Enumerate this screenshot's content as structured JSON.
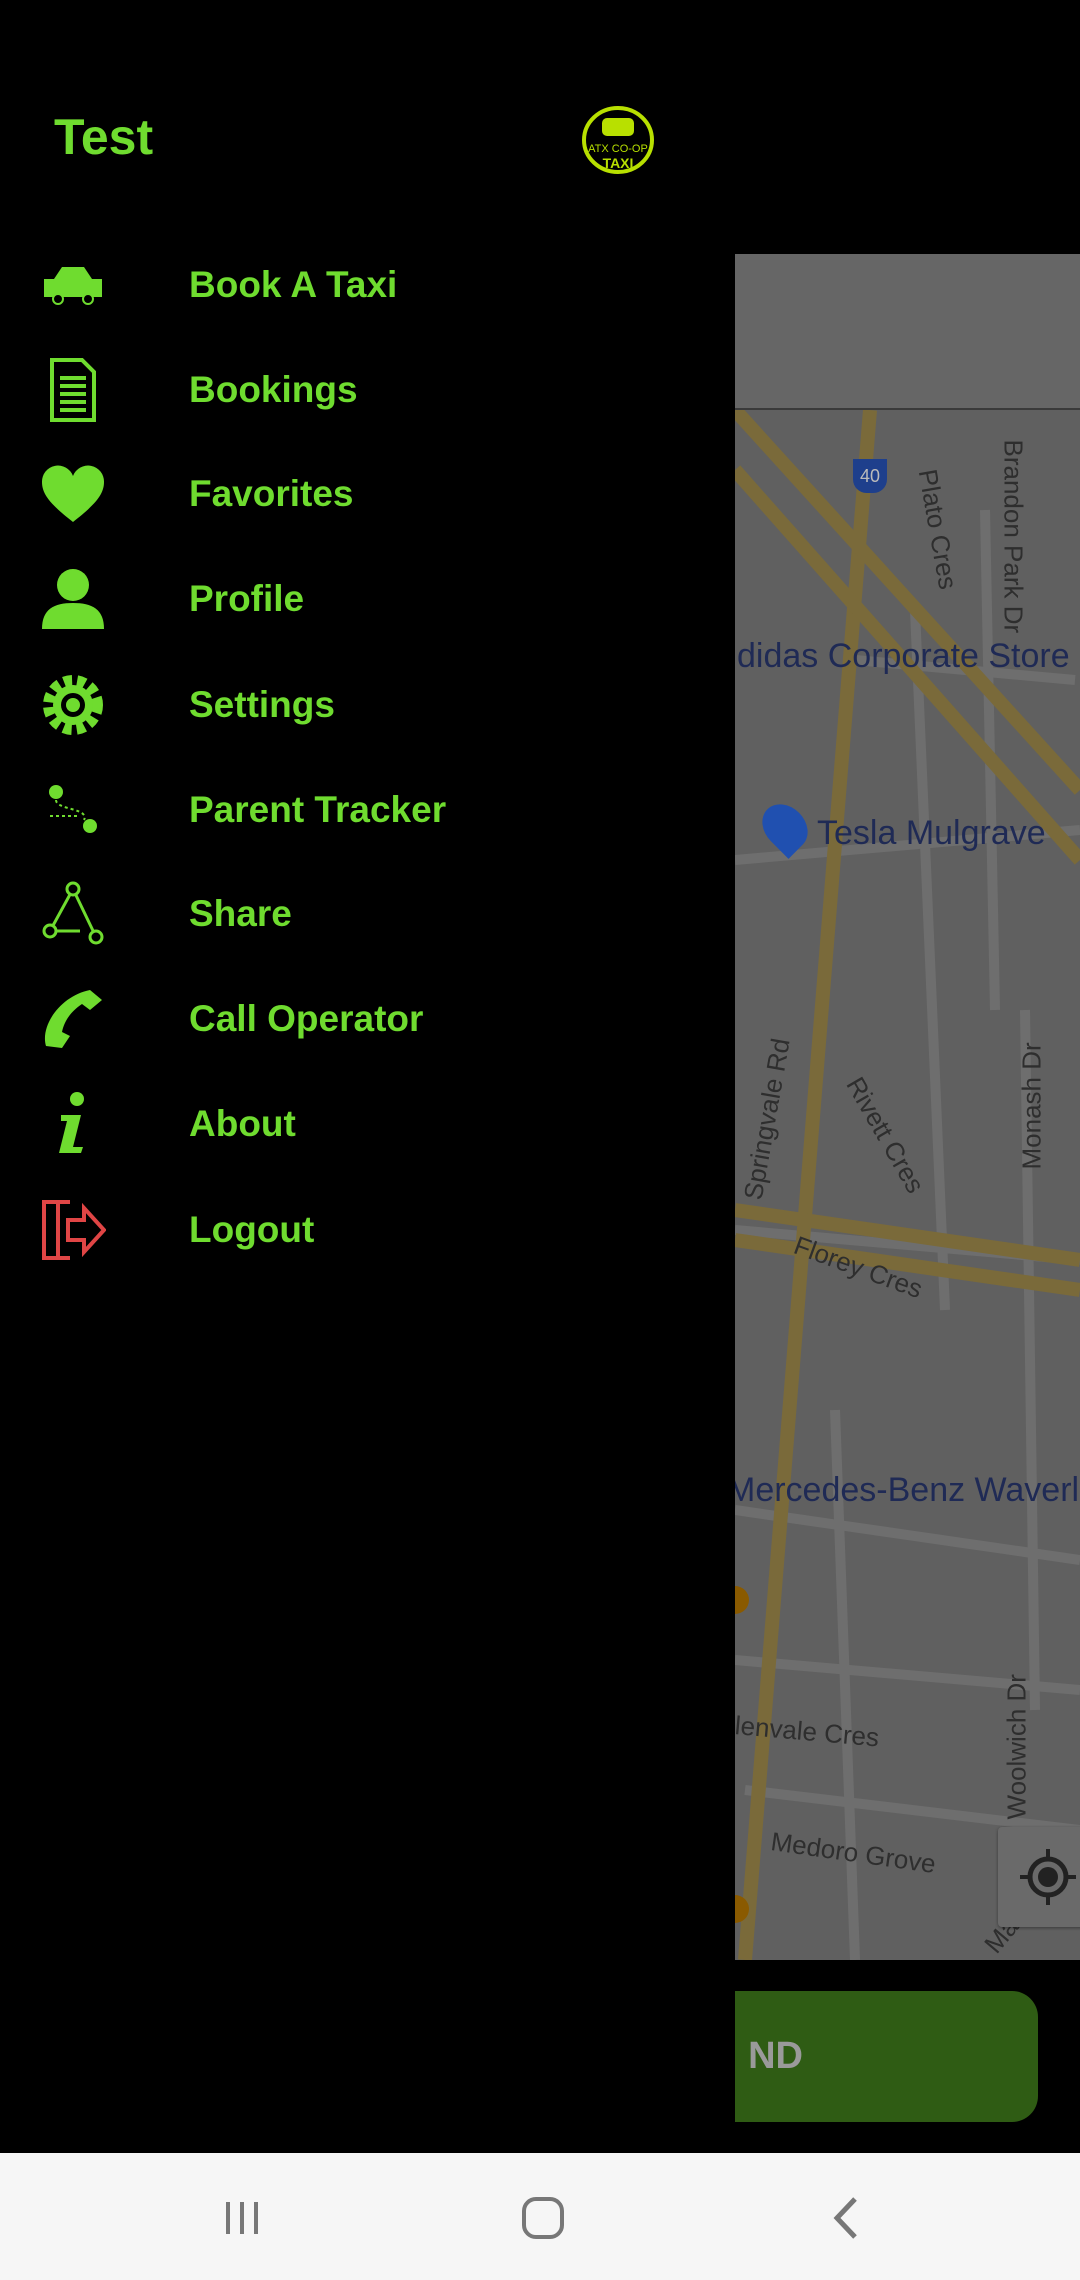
{
  "drawer": {
    "title": "Test",
    "logo_text": "ATX CO-OP TAXI",
    "items": [
      {
        "label": "Book A Taxi",
        "icon": "car-icon"
      },
      {
        "label": "Bookings",
        "icon": "document-icon"
      },
      {
        "label": "Favorites",
        "icon": "heart-icon"
      },
      {
        "label": "Profile",
        "icon": "person-icon"
      },
      {
        "label": "Settings",
        "icon": "gear-icon"
      },
      {
        "label": "Parent Tracker",
        "icon": "route-icon"
      },
      {
        "label": "Share",
        "icon": "share-icon"
      },
      {
        "label": "Call Operator",
        "icon": "phone-icon"
      },
      {
        "label": "About",
        "icon": "info-icon"
      },
      {
        "label": "Logout",
        "icon": "logout-icon"
      }
    ],
    "accent": "#6fdc2f",
    "logout_color": "#e04545"
  },
  "map": {
    "labels": [
      "didas Corporate Store",
      "Tesla Mulgrave",
      "Mercedes-Benz Waverl"
    ],
    "roads": [
      "Springvale Rd",
      "Rivett Cres",
      "Monash Dr",
      "Florey Cres",
      "lenvale Cres",
      "Medoro Grove",
      "Woolwich Dr",
      "Mackie Rd",
      "Plato Cres",
      "Brandon Park Dr"
    ],
    "shield": "40"
  },
  "confirm_button": {
    "label": "ND"
  }
}
